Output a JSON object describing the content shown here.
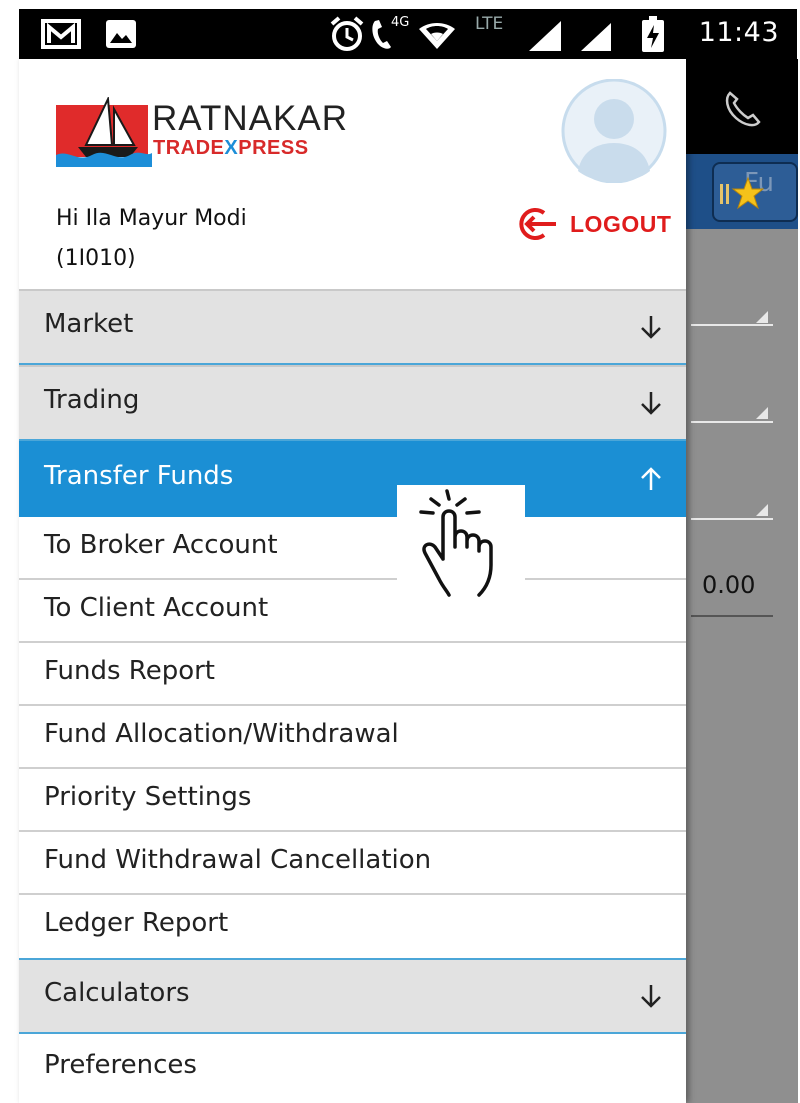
{
  "status_bar": {
    "time": "11:43",
    "network_4g": "4G",
    "network_lte": "LTE",
    "icons": [
      "gmail-icon",
      "image-icon",
      "alarm-icon",
      "volte-call-icon",
      "wifi-icon",
      "signal-icon",
      "signal-icon",
      "battery-charging-icon"
    ]
  },
  "drawer": {
    "brand": {
      "name": "RATNAKAR",
      "tagline_red": "TRADE",
      "tagline_blue": "X",
      "tagline_red2": "PRESS"
    },
    "greeting_line1": "Hi Ila Mayur Modi",
    "greeting_line2": "(1I010)",
    "logout_label": "LOGOUT",
    "menu": {
      "market": "Market",
      "trading": "Trading",
      "transfer_funds": "Transfer Funds",
      "transfer_items": [
        "To Broker Account",
        "To Client Account",
        "Funds Report",
        "Fund Allocation/Withdrawal",
        "Priority Settings",
        "Fund Withdrawal Cancellation",
        "Ledger Report"
      ],
      "calculators": "Calculators",
      "preferences": "Preferences"
    }
  },
  "background_app": {
    "tab_text": "Fu",
    "value": "0.00"
  },
  "colors": {
    "accent": "#1b8fd4",
    "section_bg": "#e2e2e2",
    "logout": "#e01c1c",
    "status_bar": "#000000"
  }
}
